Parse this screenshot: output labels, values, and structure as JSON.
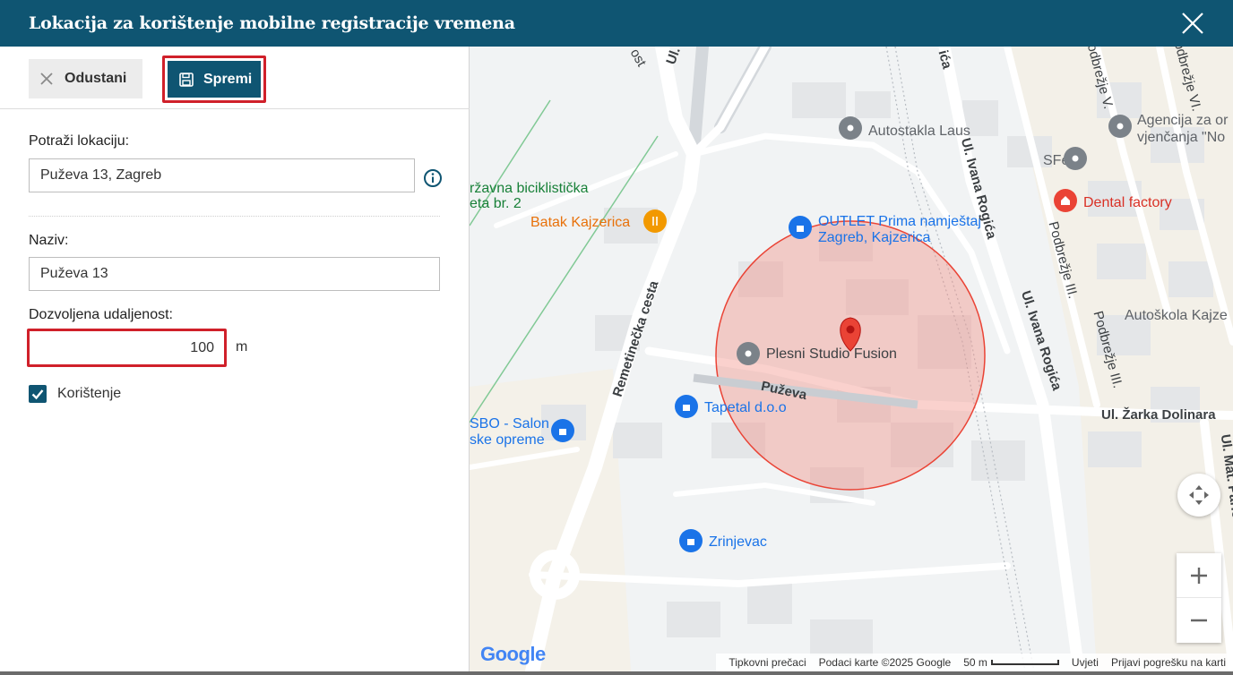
{
  "dialog": {
    "title": "Lokacija za korištenje mobilne registracije vremena"
  },
  "toolbar": {
    "cancel_label": "Odustani",
    "save_label": "Spremi"
  },
  "form": {
    "search_label": "Potraži lokaciju:",
    "search_value": "Puževa 13, Zagreb",
    "name_label": "Naziv:",
    "name_value": "Puževa 13",
    "distance_label": "Dozvoljena udaljenost:",
    "distance_value": "100",
    "distance_unit": "m",
    "usage_label": "Korištenje",
    "usage_checked": true
  },
  "map": {
    "places": {
      "autostakla": "Autostakla Laus",
      "agencija_1": "Agencija za or",
      "agencija_2": "vjenčanja \"No",
      "sfera": "SFera",
      "dental": "Dental factory",
      "outlet_1": "OUTLET Prima namještaj",
      "outlet_2": "Zagreb, Kajzerica",
      "batak": "Batak Kajzerica",
      "biciklisticka_1": "ržavna biciklistička",
      "biciklisticka_2": "eta br. 2",
      "plesni": "Plesni Studio Fusion",
      "tapetal": "Tapetal d.o.o",
      "sbo_1": "SBO - Salon",
      "sbo_2": "ske opreme",
      "zrinjevac": "Zrinjevac",
      "autoskola": "Autoškola Kajze"
    },
    "roads": {
      "puzeva": "Puževa",
      "remetinecka": "Remetinečka cesta",
      "ivana_rogica_1": "Ul. Ivana Rogića",
      "ivana_rogica_2": "Ul. Ivana Rogića",
      "zarka": "Ul. Žarka Dolinara",
      "podbrezje_3a": "Podbrežje III.",
      "podbrezje_3b": "Podbrežje III.",
      "podbrezje_5": "Podbrežje V.",
      "podbrezje_6": "Podbrežje VI.",
      "marina": "Ul. Mat. Parlova",
      "top_ul": "Ul.",
      "top_rogica": "ića",
      "top_ost": "ost"
    },
    "radius_m": 100,
    "colors": {
      "circle_fill": "#f28b82",
      "circle_stroke": "#ea4335",
      "marker": "#ea4335"
    },
    "footer": {
      "shortcuts": "Tipkovni prečaci",
      "data": "Podaci karte ©2025 Google",
      "scale": "50 m",
      "terms": "Uvjeti",
      "report": "Prijavi pogrešku na karti"
    },
    "logo": "Google"
  }
}
